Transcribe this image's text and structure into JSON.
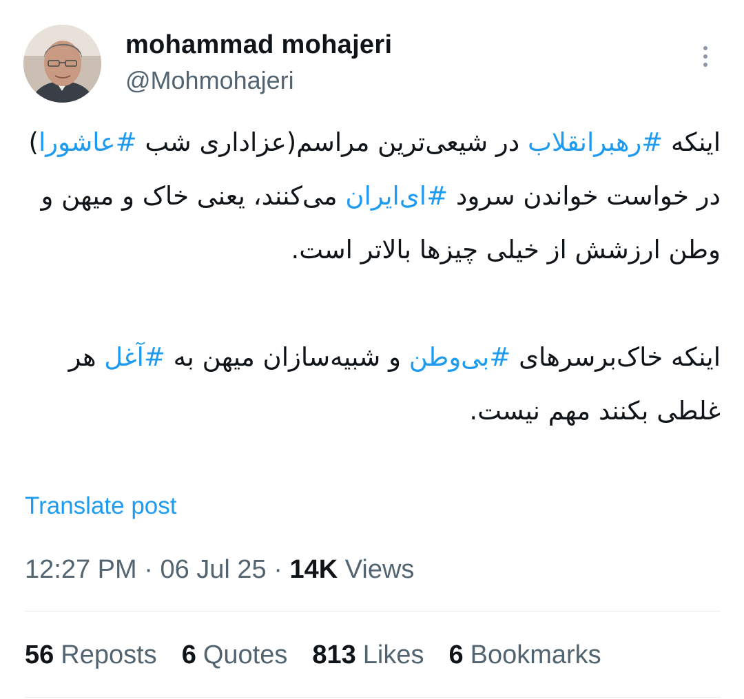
{
  "author": {
    "display_name": "mohammad mohajeri",
    "handle": "@Mohmohajeri"
  },
  "tweet": {
    "paragraphs": [
      [
        {
          "text": "اینکه ",
          "hashtag": false
        },
        {
          "text": "#رهبرانقلاب",
          "hashtag": true
        },
        {
          "text": " در شیعی‌ترین مراسم(عزاداری شب ",
          "hashtag": false
        },
        {
          "text": "#عاشورا",
          "hashtag": true
        },
        {
          "text": ") در خواست خواندن سرود ",
          "hashtag": false
        },
        {
          "text": "#ای‌ایران",
          "hashtag": true
        },
        {
          "text": " می‌کنند، یعنی خاک و میهن و وطن ارزشش از خیلی چیزها بالاتر است.",
          "hashtag": false
        }
      ],
      [
        {
          "text": "اینکه خاک‌برسرهای ",
          "hashtag": false
        },
        {
          "text": "#بی‌وطن",
          "hashtag": true
        },
        {
          "text": " و شبیه‌سازان میهن به ",
          "hashtag": false
        },
        {
          "text": "#آغل",
          "hashtag": true
        },
        {
          "text": " هر غلطی بکنند مهم نیست.",
          "hashtag": false
        }
      ]
    ],
    "translate_label": "Translate post",
    "time": "12:27 PM",
    "separator": " · ",
    "date": "06 Jul 25",
    "views_count": "14K",
    "views_label": "Views"
  },
  "stats": [
    {
      "count": "56",
      "label": "Reposts"
    },
    {
      "count": "6",
      "label": "Quotes"
    },
    {
      "count": "813",
      "label": "Likes"
    },
    {
      "count": "6",
      "label": "Bookmarks"
    }
  ],
  "colors": {
    "text": "#0f1419",
    "secondary": "#536471",
    "accent": "#1d9bf0",
    "divider": "#e6ebee"
  },
  "icons": {
    "more": "more-vertical-icon"
  }
}
